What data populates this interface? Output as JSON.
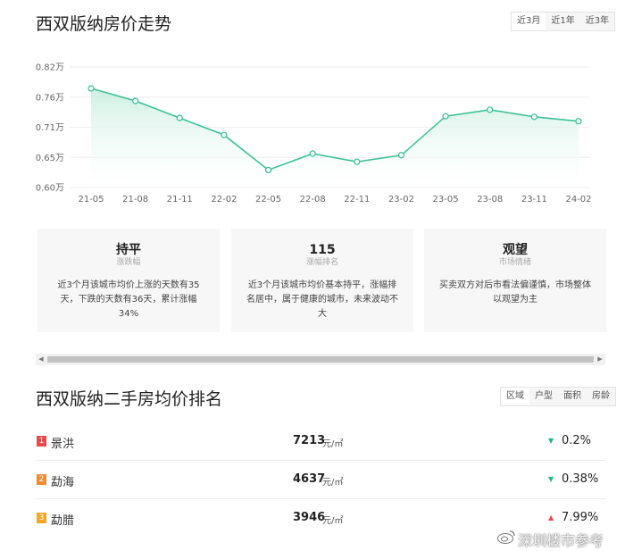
{
  "page": {
    "trend_title": "西双版纳房价走势",
    "ranking_title": "西双版纳二手房均价排名"
  },
  "range_tabs": [
    "近3月",
    "近1年",
    "近3年"
  ],
  "sort_tabs": [
    "区域",
    "户型",
    "面积",
    "房龄"
  ],
  "chart_data": {
    "type": "area",
    "x_ticks": [
      "21-05",
      "21-08",
      "21-11",
      "22-02",
      "22-05",
      "22-08",
      "22-11",
      "23-02",
      "23-05",
      "23-08",
      "23-11",
      "24-02"
    ],
    "y_ticks": [
      "0.60万",
      "0.65万",
      "0.71万",
      "0.76万",
      "0.82万"
    ],
    "ylim": [
      0.6,
      0.82
    ],
    "series": [
      {
        "values": [
          0.781,
          0.758,
          0.727,
          0.696,
          0.632,
          0.662,
          0.647,
          0.659,
          0.73,
          0.742,
          0.729,
          0.721
        ]
      }
    ],
    "colors": {
      "line": "#3cc397",
      "fill_top": "#c9efe0",
      "fill_bottom": "#ffffff",
      "grid": "#eeeeee"
    },
    "grid": true
  },
  "cards": [
    {
      "value": "持平",
      "label": "涨跌幅",
      "desc": "近3个月该城市均价上涨的天数有35天，下跌的天数有36天，累计涨幅34%"
    },
    {
      "value": "115",
      "label": "涨幅排名",
      "desc": "近3个月该城市均价基本持平，涨幅排名居中，属于健康的城市，未来波动不大"
    },
    {
      "value": "观望",
      "label": "市场情绪",
      "desc": "买卖双方对后市看法偏谨慎，市场整体以观望为主"
    }
  ],
  "ranking": [
    {
      "rank": "1",
      "name": "景洪",
      "price": "7213",
      "unit": "元/㎡",
      "change": "0.2%",
      "direction": "down",
      "rank_color": "#e84a4a"
    },
    {
      "rank": "2",
      "name": "勐海",
      "price": "4637",
      "unit": "元/㎡",
      "change": "0.38%",
      "direction": "down",
      "rank_color": "#f08c2e"
    },
    {
      "rank": "3",
      "name": "勐腊",
      "price": "3946",
      "unit": "元/㎡",
      "change": "7.99%",
      "direction": "up",
      "rank_color": "#f5a623"
    }
  ],
  "status_colors": {
    "down": "#1fb885",
    "up": "#e84a4a"
  },
  "watermark": "深圳楼市参考"
}
